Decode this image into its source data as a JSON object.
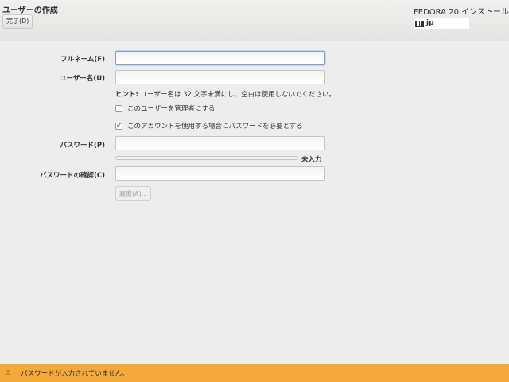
{
  "header": {
    "title": "ユーザーの作成",
    "done_label": "完了(D)",
    "product": "FEDORA 20 インストール",
    "keyboard_layout": "jp"
  },
  "form": {
    "fullname_label": "フルネーム(F)",
    "fullname_value": "",
    "username_label": "ユーザー名(U)",
    "username_value": "",
    "hint_prefix": "ヒント:",
    "hint_text": "ユーザー名は 32 文字未満にし、空白は使用しないでください。",
    "admin_label": "このユーザーを管理者にする",
    "admin_checked": false,
    "require_password_label": "このアカウントを使用する場合にパスワードを必要とする",
    "require_password_checked": true,
    "password_label": "パスワード(P)",
    "password_value": "",
    "strength_label": "未入力",
    "strength_fraction": 0,
    "confirm_label": "パスワードの確認(C)",
    "confirm_value": "",
    "advanced_label": "高度(A)..."
  },
  "warning": {
    "icon": "warning-icon",
    "text": "パスワードが入力されていません。",
    "color": "#f6a93b"
  }
}
